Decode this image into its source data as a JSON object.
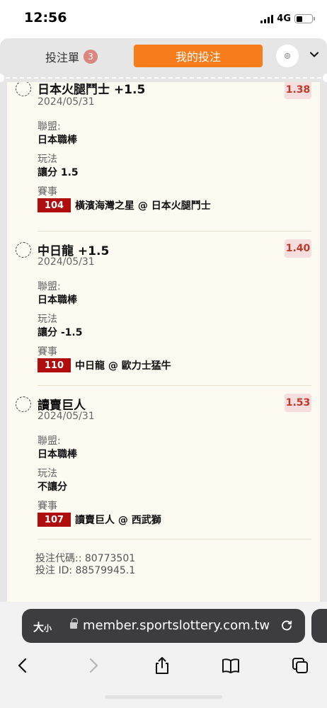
{
  "status": {
    "time": "12:56",
    "network": "4G"
  },
  "header": {
    "slip_label": "投注單",
    "slip_count": "3",
    "mybets_label": "我的投注"
  },
  "bets": [
    {
      "selection": "日本火腿鬥士 +1.5",
      "date": "2024/05/31",
      "odds": "1.38",
      "league_label": "聯盟:",
      "league": "日本職棒",
      "market_label": "玩法",
      "market": "讓分 1.5",
      "event_label": "賽事",
      "match_no": "104",
      "match": "橫濱海灣之星 @ 日本火腿鬥士"
    },
    {
      "selection": "中日龍 +1.5",
      "date": "2024/05/31",
      "odds": "1.40",
      "league_label": "聯盟:",
      "league": "日本職棒",
      "market_label": "玩法",
      "market": "讓分 -1.5",
      "event_label": "賽事",
      "match_no": "110",
      "match": "中日龍 @ 歐力士猛牛"
    },
    {
      "selection": "讀賣巨人",
      "date": "2024/05/31",
      "odds": "1.53",
      "league_label": "聯盟:",
      "league": "日本職棒",
      "market_label": "玩法",
      "market": "不讓分",
      "event_label": "賽事",
      "match_no": "107",
      "match": "讀賣巨人 @ 西武獅"
    }
  ],
  "footer": {
    "bet_code": "投注代碼:: 80773501",
    "bet_id": "投注 ID: 88579945.1"
  },
  "browser": {
    "text_size_label": "大",
    "text_size_small": "小",
    "url": "member.sportslottery.com.tw"
  }
}
